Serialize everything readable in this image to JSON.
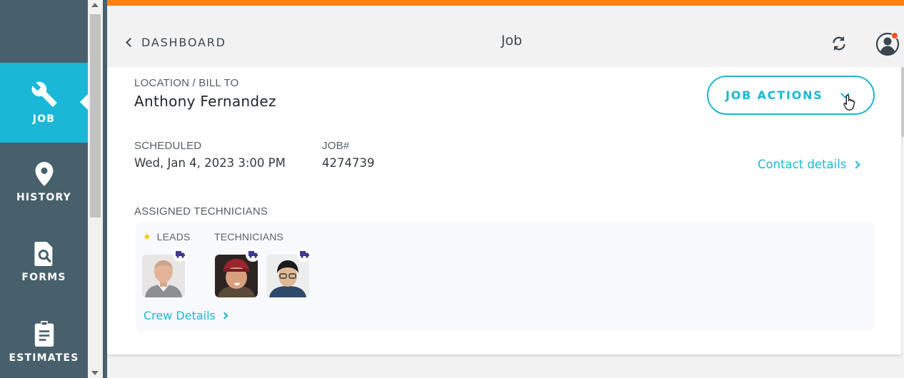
{
  "sidebar": {
    "items": [
      {
        "label": "JOB",
        "icon": "wrench-icon",
        "active": true
      },
      {
        "label": "HISTORY",
        "icon": "location-pin-icon",
        "active": false
      },
      {
        "label": "FORMS",
        "icon": "form-search-icon",
        "active": false
      },
      {
        "label": "ESTIMATES",
        "icon": "clipboard-icon",
        "active": false
      }
    ]
  },
  "header": {
    "back_label": "DASHBOARD",
    "title": "Job",
    "refresh_icon": "refresh-icon",
    "profile_icon": "user-profile-icon"
  },
  "job": {
    "location_caption": "LOCATION / BILL TO",
    "customer_name": "Anthony Fernandez",
    "scheduled_caption": "SCHEDULED",
    "scheduled_value": "Wed, Jan 4, 2023 3:00 PM",
    "job_number_caption": "JOB#",
    "job_number_value": "4274739",
    "actions_label": "JOB ACTIONS",
    "contact_label": "Contact details"
  },
  "crew": {
    "caption": "ASSIGNED TECHNICIANS",
    "leads_label": "LEADS",
    "technicians_label": "TECHNICIANS",
    "crew_details_label": "Crew Details",
    "members": [
      {
        "role": "lead",
        "icon": "truck-icon"
      },
      {
        "role": "technician",
        "icon": "truck-icon"
      },
      {
        "role": "technician",
        "icon": "truck-icon"
      }
    ]
  },
  "colors": {
    "accent": "#1ab7d6",
    "sidebar": "#47606b",
    "top_bar": "#fb7f12",
    "notification": "#f2541b"
  }
}
